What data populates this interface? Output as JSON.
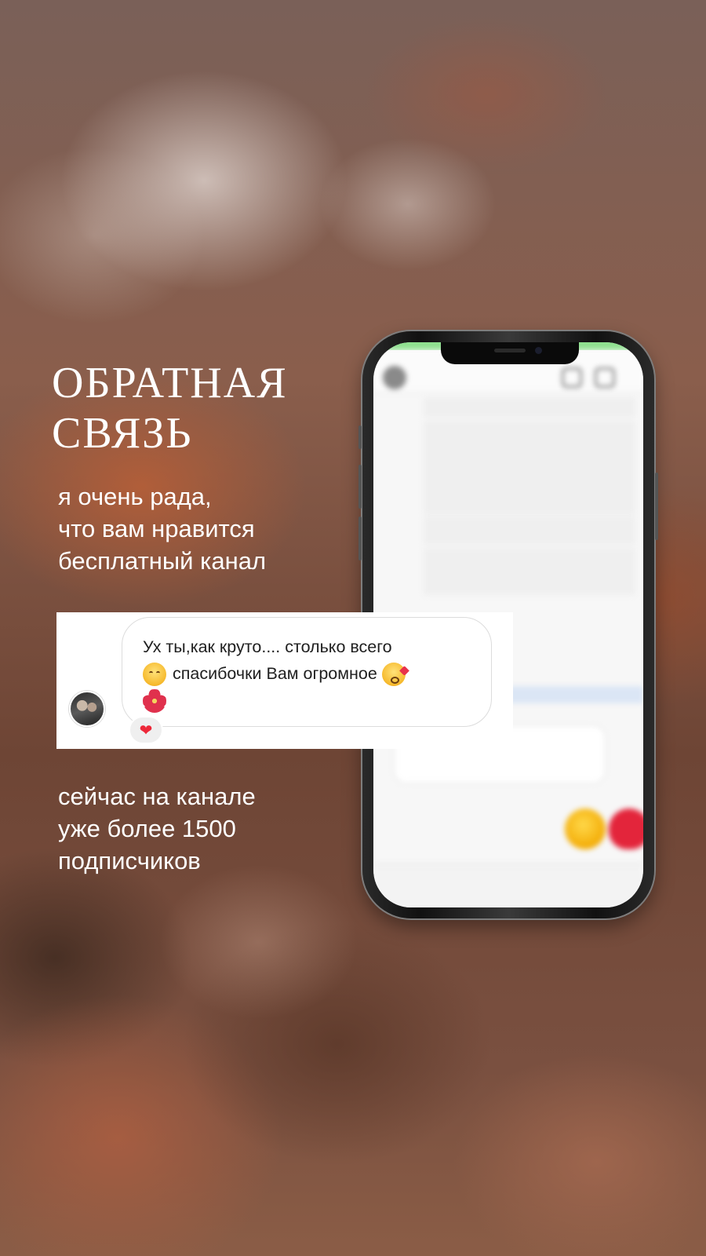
{
  "title": {
    "line1": "Обратная",
    "line2": "связь"
  },
  "intro": {
    "line1": "я очень рада,",
    "line2": "что вам нравится",
    "line3": "бесплатный канал"
  },
  "comment": {
    "line1": "Ух ты,как круто.... столько всего",
    "line2": "спасибочки Вам огромное",
    "emoji": [
      "hugging-face",
      "face-blowing-kiss",
      "hibiscus"
    ],
    "reaction": "❤"
  },
  "stats": {
    "line1": "сейчас на канале",
    "line2": "уже более 1500",
    "line3": "подписчиков"
  },
  "colors": {
    "text": "#ffffff",
    "reaction_heart": "#ed2839",
    "phone_status_tint": "#8fe08f"
  }
}
